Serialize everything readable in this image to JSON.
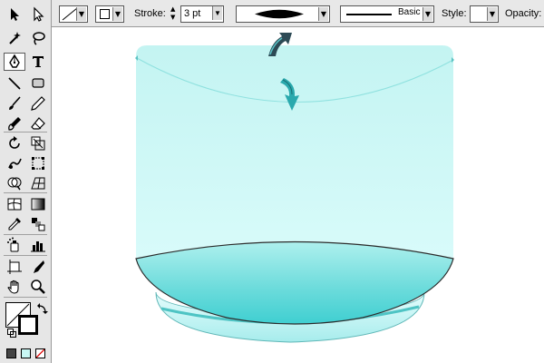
{
  "control_bar": {
    "stroke_label": "Stroke:",
    "stroke_weight": "3 pt",
    "brush_profile_label": "Basic",
    "style_label": "Style:",
    "opacity_label": "Opacity:"
  },
  "colors": {
    "jar_fill": "#c8f7f4",
    "jar_edge": "#9ae6e3",
    "base_top": "#56d6d6",
    "base_bottom": "#b8f2f1",
    "arrow_teal": "#2fb5b8",
    "panel_bg": "#e6e6e6"
  },
  "tools": [
    "selection-tool",
    "direct-selection-tool",
    "magic-wand-tool",
    "lasso-tool",
    "pen-tool",
    "type-tool",
    "line-segment-tool",
    "rectangle-tool",
    "paintbrush-tool",
    "pencil-tool",
    "blob-brush-tool",
    "eraser-tool",
    "rotate-tool",
    "scale-tool",
    "warp-tool",
    "free-transform-tool",
    "shape-builder-tool",
    "perspective-grid-tool",
    "mesh-tool",
    "gradient-tool",
    "eyedropper-tool",
    "blend-tool",
    "symbol-sprayer-tool",
    "column-graph-tool",
    "artboard-tool",
    "slice-tool",
    "hand-tool",
    "zoom-tool"
  ]
}
